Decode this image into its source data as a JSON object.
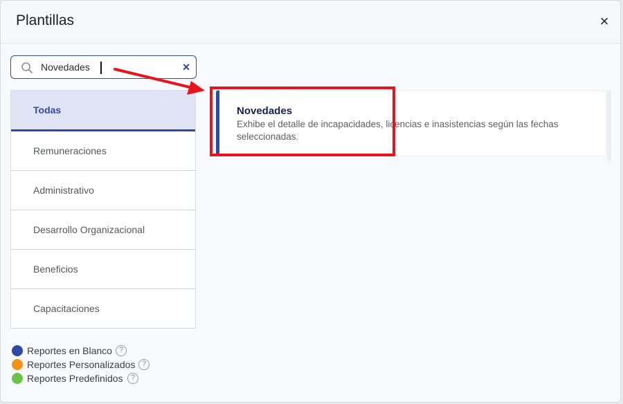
{
  "modal": {
    "title": "Plantillas",
    "close_glyph": "×"
  },
  "search": {
    "value": "Novedades",
    "placeholder": "",
    "clear_glyph": "×"
  },
  "categories": [
    {
      "label": "Todas",
      "active": true
    },
    {
      "label": "Remuneraciones"
    },
    {
      "label": "Administrativo"
    },
    {
      "label": "Desarrollo Organizacional"
    },
    {
      "label": "Beneficios"
    },
    {
      "label": "Capacitaciones"
    }
  ],
  "legend": [
    {
      "label": "Reportes en Blanco",
      "color": "#2f4aa5"
    },
    {
      "label": "Reportes Personalizados",
      "color": "#f39313"
    },
    {
      "label": "Reportes Predefinidos",
      "color": "#6cc24a"
    }
  ],
  "help_glyph": "?",
  "results": [
    {
      "title": "Novedades",
      "description": "Exhibe el detalle de incapacidades, licencias e inasistencias según las fechas seleccionadas.",
      "accent": "#2f4aa5"
    }
  ],
  "annotation_color": "#e8141b"
}
